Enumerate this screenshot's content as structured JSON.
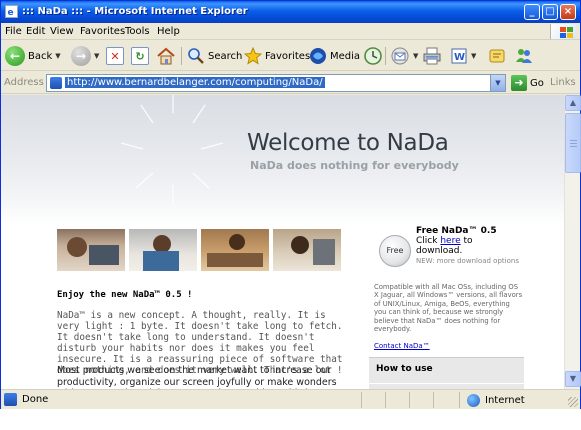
{
  "window": {
    "title": "::: NaDa ::: - Microsoft Internet Explorer",
    "controls": [
      "minimize",
      "maximize",
      "close"
    ]
  },
  "menu": {
    "items": [
      "File",
      "Edit",
      "View",
      "Favorites",
      "Tools",
      "Help"
    ]
  },
  "toolbar": {
    "back_label": "Back",
    "search_label": "Search",
    "favorites_label": "Favorites",
    "media_label": "Media"
  },
  "address": {
    "label": "Address",
    "url": "http://www.bernardbelanger.com/computing/NaDa/",
    "go_label": "Go",
    "links_label": "Links"
  },
  "page": {
    "heading": "Welcome to NaDa",
    "tagline": "NaDa does nothing for everybody",
    "enjoy_heading": "Enjoy the new NaDa™ 0.5 !",
    "intro_paragraph": "NaDa™ is a new concept. A thought, really. It is very light : 1 byte. It doesn't take long to fetch. It doesn't take long to understand. It doesn't disturb your habits nor does it makes you feel insecure. It is a reassuring piece of software that does nothing, and does it very well. That's a lot !",
    "second_paragraph": "Most products we see on the market want to increase our productivity, organize our screen joyfully or make wonders with our sound card, but NaDa™ does nothing. This is a revolutionary whole new approach, a concept far beyond what you usually",
    "free_badge": "Free",
    "download_title": "Free NaDa™ 0.5",
    "download_click": "Click",
    "download_link": "here",
    "download_to": "to",
    "download_word": "download.",
    "download_note": "NEW: more download options",
    "compat_text": "Compatible with all Mac OSs, including OS X Jaguar, all Windows™ versions, all flavors of UNIX/Linux, Amiga, BeOS, everything you can think of, because we strongly believe that NaDa™ does nothing for everybody.",
    "contact_link": "Contact NaDa™",
    "howto_heading": "How to use"
  },
  "status": {
    "text": "Done",
    "zone": "Internet"
  },
  "colors": {
    "titlebar": "#0a5ee8",
    "chrome": "#ece9d8",
    "link": "#0000cc",
    "selection": "#316ac5"
  },
  "icons": [
    "ie-page-icon",
    "windows-logo-icon",
    "back-arrow-icon",
    "forward-arrow-icon",
    "stop-icon",
    "refresh-icon",
    "home-icon",
    "search-icon",
    "favorites-star-icon",
    "media-icon",
    "history-icon",
    "mail-icon",
    "print-icon",
    "edit-icon",
    "discuss-icon",
    "messenger-icon",
    "go-arrow-icon",
    "globe-icon"
  ]
}
